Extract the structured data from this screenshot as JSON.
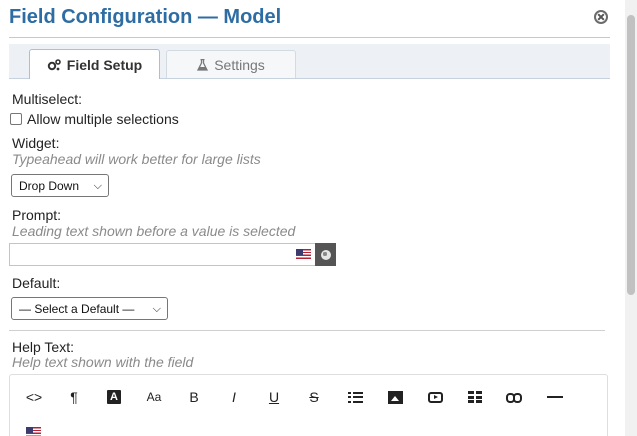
{
  "dialog": {
    "title": "Field Configuration — Model",
    "close_icon": "close-circle-icon"
  },
  "tabs": [
    {
      "label": "Field Setup",
      "icon": "gears-icon",
      "active": true
    },
    {
      "label": "Settings",
      "icon": "flask-icon",
      "active": false
    }
  ],
  "multiselect": {
    "label": "Multiselect:",
    "checkbox_label": "Allow multiple selections",
    "checked": false
  },
  "widget": {
    "label": "Widget:",
    "hint": "Typeahead will work better for large lists",
    "selected": "Drop Down"
  },
  "prompt": {
    "label": "Prompt:",
    "hint": "Leading text shown before a value is selected",
    "value": "",
    "flag_icon": "us-flag-icon",
    "globe_icon": "globe-icon"
  },
  "default": {
    "label": "Default:",
    "selected": "— Select a Default —"
  },
  "help_text": {
    "label": "Help Text:",
    "hint": "Help text shown with the field",
    "toolbar": {
      "code": "<>",
      "paragraph": "¶",
      "text_color": "A",
      "font_size": "Aa",
      "bold": "B",
      "italic": "I",
      "underline": "U",
      "strike": "S"
    }
  },
  "colors": {
    "title": "#2e6da4",
    "tab_bar": "#edf1f5",
    "hint": "#8a8a8a"
  }
}
